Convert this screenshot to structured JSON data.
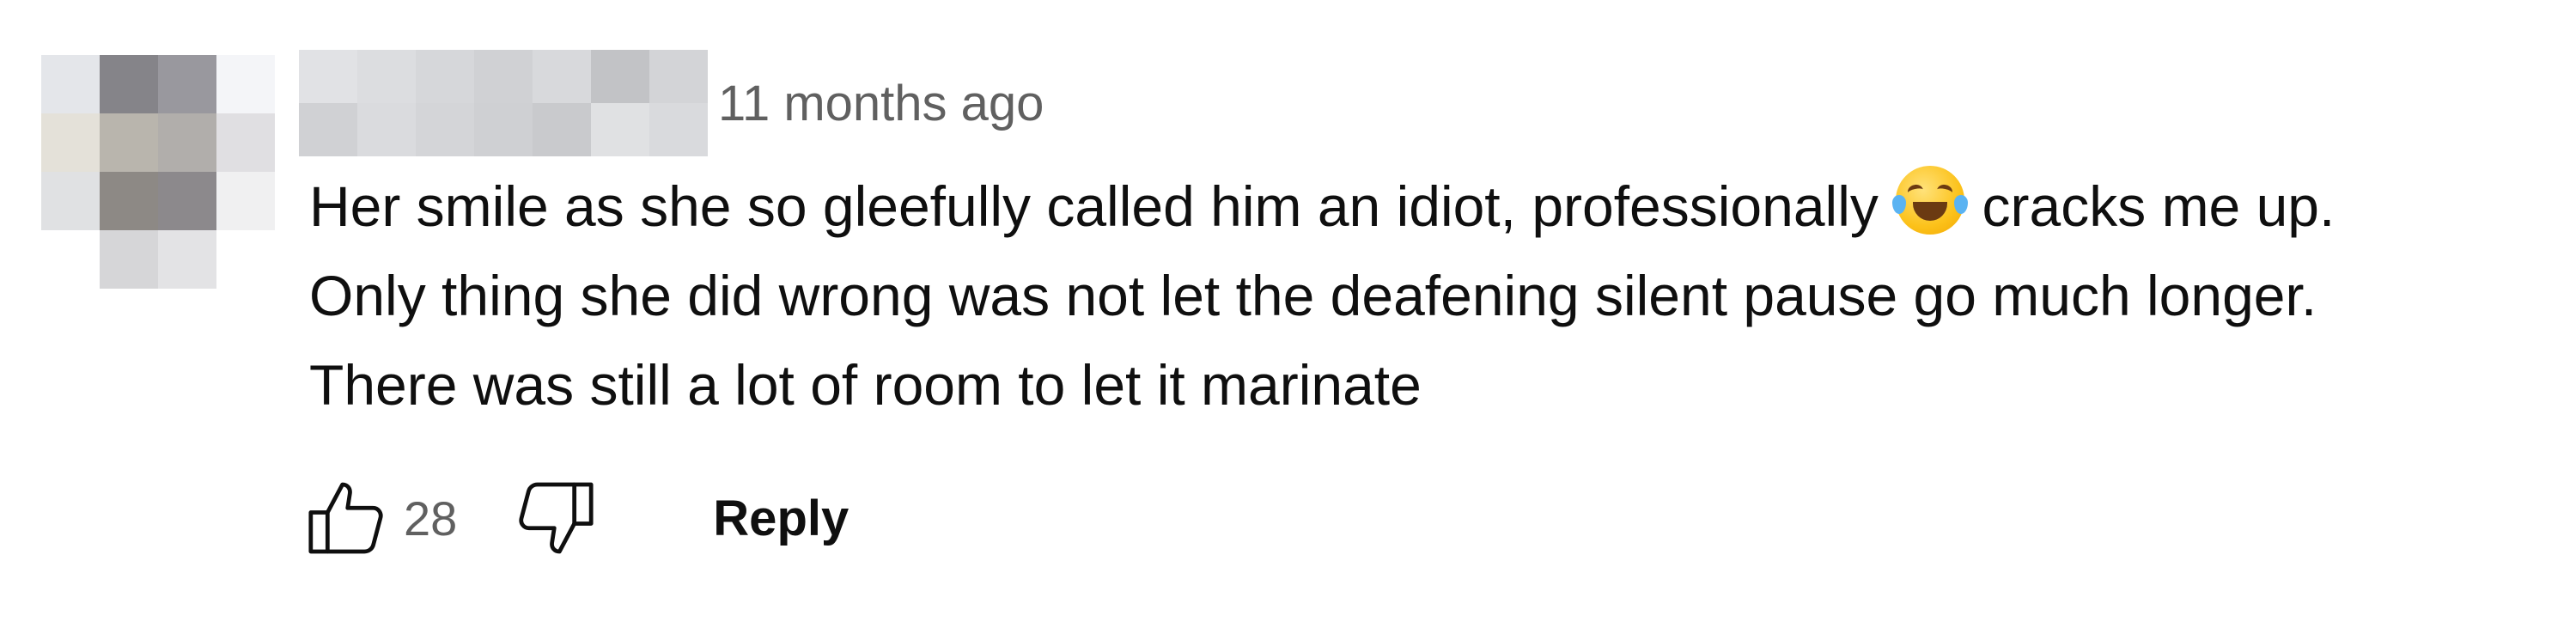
{
  "comment": {
    "timestamp": "11 months ago",
    "text_lines": [
      "Her smile as she so gleefully called him an idiot, professionally",
      "cracks me up.",
      "Only thing she did wrong was not let the deafening silent pause go much longer.",
      "There was still a lot of room to let it marinate"
    ],
    "emoji": "face-with-tears-of-joy",
    "avatar_icon": "pixelated-avatar",
    "author_icon": "pixelated-author-name"
  },
  "actions": {
    "like_icon": "thumbs-up-icon",
    "like_count": "28",
    "dislike_icon": "thumbs-down-icon",
    "reply_label": "Reply"
  },
  "colors": {
    "text_primary": "#0f0f0f",
    "text_secondary": "#606060",
    "background": "#ffffff"
  }
}
